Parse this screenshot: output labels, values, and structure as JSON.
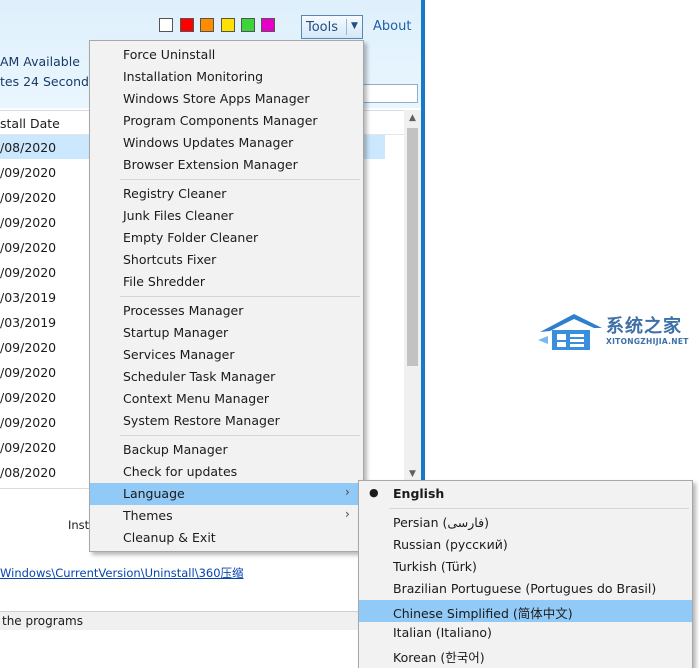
{
  "colors": {
    "swatches": [
      "#ffffff",
      "#ff0000",
      "#ff8c00",
      "#ffe000",
      "#3cd63c",
      "#e800c8"
    ],
    "menu_highlight": "#91c9f7",
    "list_selection": "#cce8ff"
  },
  "header": {
    "tools_label": "Tools",
    "about_label": "About",
    "ram_text": "AM Available",
    "uptime_text": "tes 24 Seconds"
  },
  "list": {
    "column_header": "stall Date",
    "rows": [
      "/08/2020",
      "/09/2020",
      "/09/2020",
      "/09/2020",
      "/09/2020",
      "/09/2020",
      "/03/2019",
      "/03/2019",
      "/09/2020",
      "/09/2020",
      "/09/2020",
      "/09/2020",
      "/09/2020",
      "/08/2020"
    ]
  },
  "details": {
    "install_label": "Inst",
    "registry_path": "Windows\\CurrentVersion\\Uninstall\\360压缩"
  },
  "status_bar": {
    "text": " the programs"
  },
  "tools_menu": {
    "groups": [
      [
        "Force Uninstall",
        "Installation Monitoring",
        "Windows Store Apps Manager",
        "Program Components Manager",
        "Windows Updates Manager",
        "Browser Extension Manager"
      ],
      [
        "Registry Cleaner",
        "Junk Files Cleaner",
        "Empty Folder Cleaner",
        "Shortcuts Fixer",
        "File Shredder"
      ],
      [
        "Processes Manager",
        "Startup Manager",
        "Services Manager",
        "Scheduler Task Manager",
        "Context Menu Manager",
        "System Restore Manager"
      ],
      [
        "Backup Manager",
        "Check for updates",
        "Language",
        "Themes",
        "Cleanup & Exit"
      ]
    ]
  },
  "language_menu": {
    "current": "English",
    "items": [
      "Persian (فارسی)",
      "Russian (русский)",
      "Turkish (Türk)",
      "Brazilian Portuguese (Portugues do Brasil)",
      "Chinese Simplified (简体中文)",
      "Italian (Italiano)",
      "Korean (한국어)"
    ]
  },
  "watermark": {
    "name": "系统之家",
    "domain": "XITONGZHIJIA.NET"
  }
}
